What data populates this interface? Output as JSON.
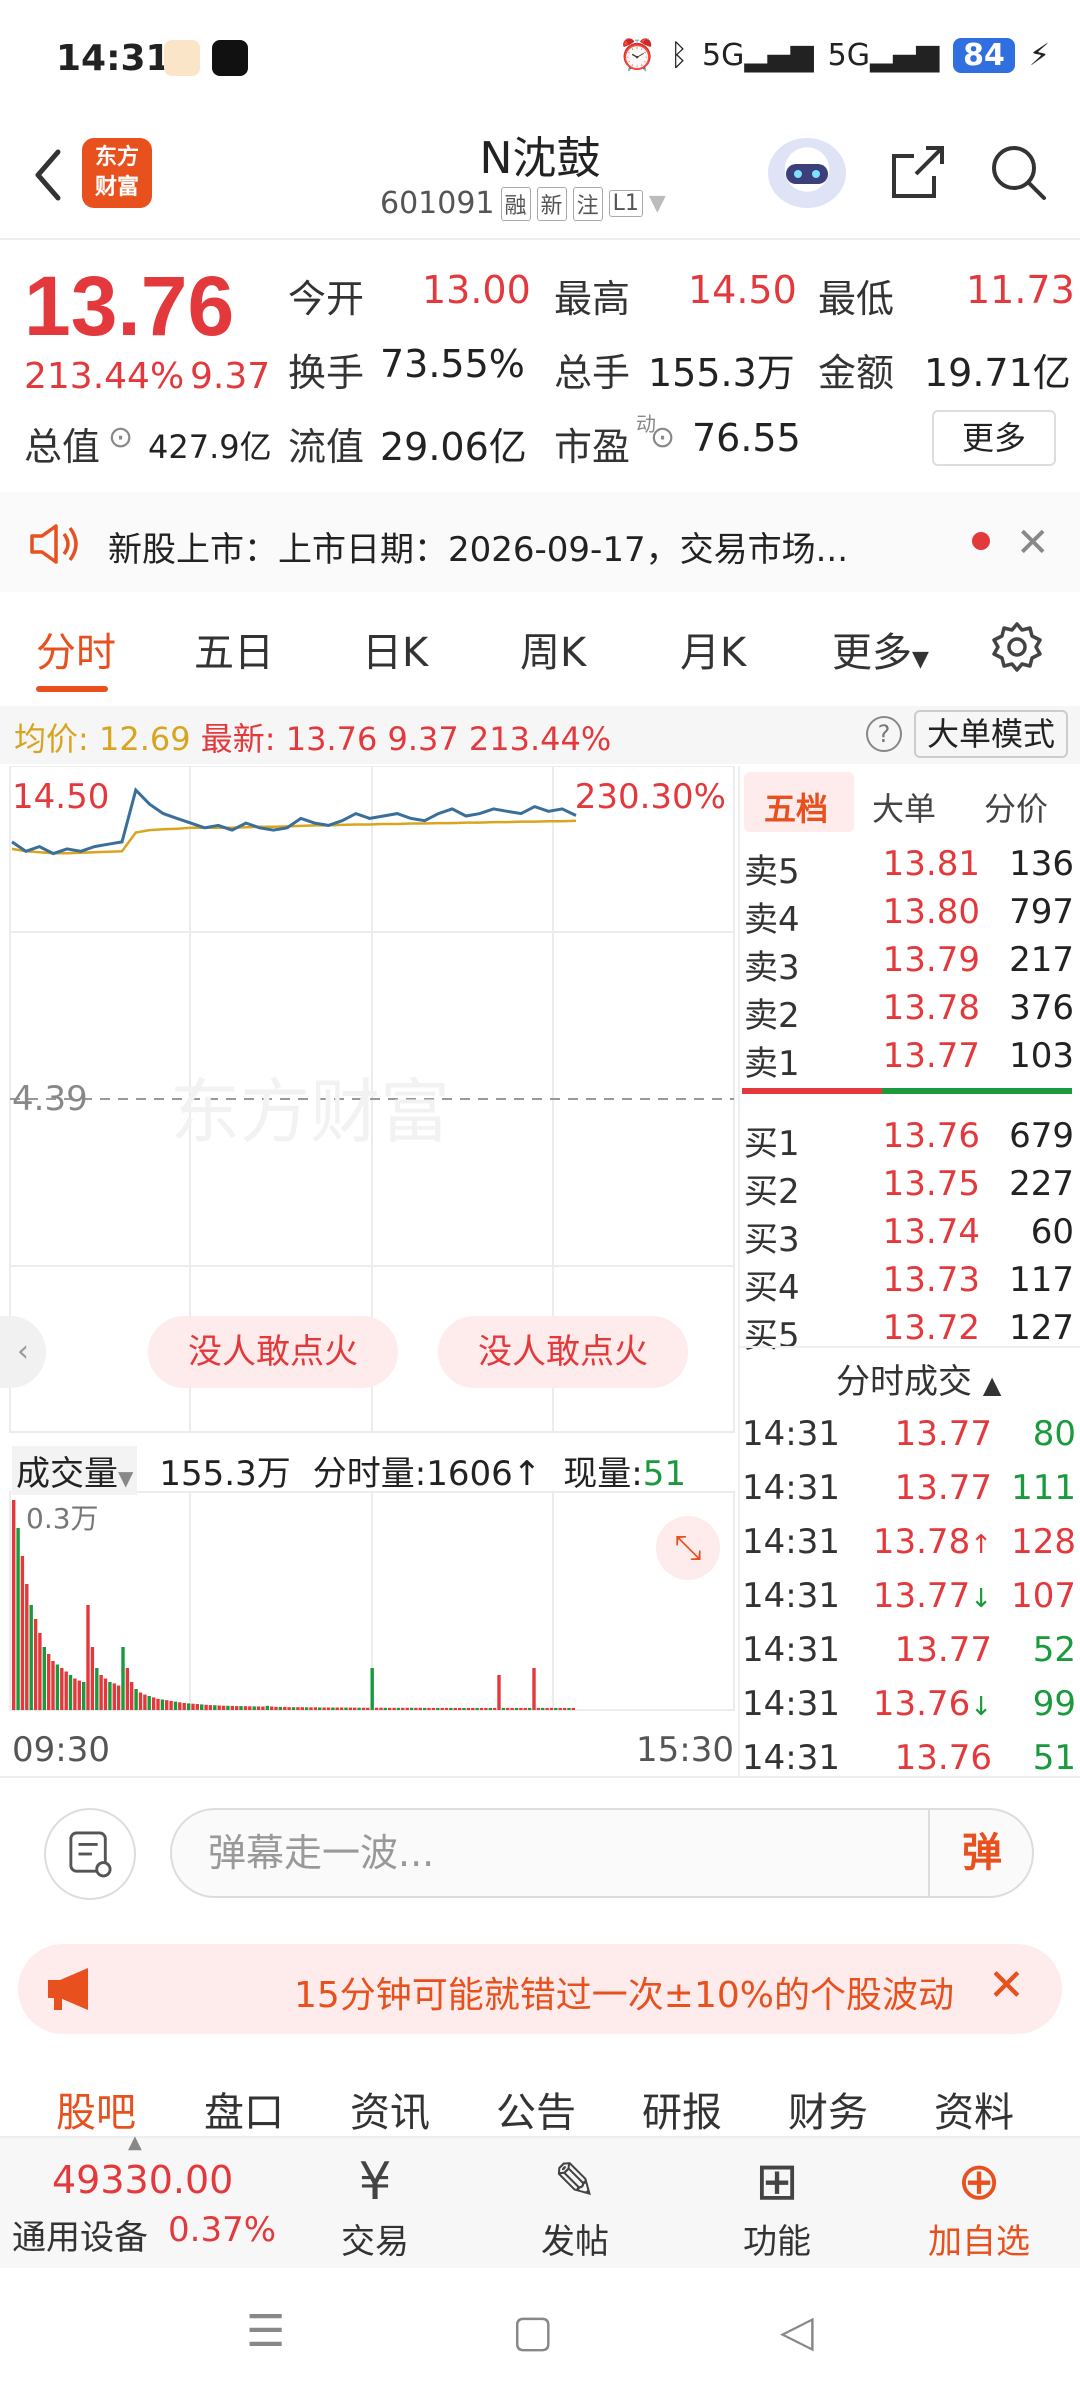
{
  "status_bar": {
    "time": "14:31",
    "signal1": "5G",
    "signal2": "5G",
    "battery": "84"
  },
  "header": {
    "logo_text_line1": "东方",
    "logo_text_line2": "财富",
    "stock_name": "N沈鼓",
    "stock_code": "601091",
    "tags": [
      "融",
      "新",
      "注",
      "L1"
    ]
  },
  "quote": {
    "price": "13.76",
    "change_pct": "213.44%",
    "change_val": "9.37",
    "open_label": "今开",
    "open": "13.00",
    "high_label": "最高",
    "high": "14.50",
    "low_label": "最低",
    "low": "11.73",
    "turnover_label": "换手",
    "turnover": "73.55%",
    "volume_label": "总手",
    "volume": "155.3万",
    "amount_label": "金额",
    "amount": "19.71亿",
    "mktcap_label": "总值",
    "mktcap": "427.9亿",
    "float_label": "流值",
    "float_cap": "29.06亿",
    "pe_label": "市盈",
    "pe_sup": "动",
    "pe": "76.55",
    "more_label": "更多"
  },
  "notice": {
    "text": "新股上市：上市日期：2026-09-17，交易市场..."
  },
  "chart_tabs": [
    "分时",
    "五日",
    "日K",
    "周K",
    "月K",
    "更多"
  ],
  "avg_bar": {
    "avg_label": "均价:",
    "avg": "12.69",
    "latest_label": "最新:",
    "latest": "13.76",
    "chg": "9.37",
    "pct": "213.44%",
    "help": "?",
    "big_order_mode": "大单模式"
  },
  "chart": {
    "y_top_label": "14.50",
    "y_top_pct": "230.30%",
    "y_mid_label": "4.39",
    "watermark": "东方财富",
    "ghost_btn": "没人敢点火",
    "vol_label": "成交量",
    "vol_total": "155.3万",
    "tick_vol_label": "分时量:",
    "tick_vol": "1606",
    "cur_vol_label": "现量:",
    "cur_vol": "51",
    "vol_scale": "0.3万",
    "time_start": "09:30",
    "time_end": "15:30"
  },
  "chart_data": {
    "type": "line",
    "series": [
      {
        "values": [
          13.2,
          13.0,
          13.1,
          12.95,
          13.05,
          13.0,
          13.1,
          13.15,
          13.2,
          14.3,
          14.0,
          13.8,
          13.7,
          13.6,
          13.5,
          13.55,
          13.45,
          13.6,
          13.5,
          13.45,
          13.5,
          13.7,
          13.6,
          13.55,
          13.65,
          13.8,
          13.7,
          13.75,
          13.8,
          13.7,
          13.65,
          13.8,
          13.9,
          13.75,
          13.8,
          13.9,
          13.85,
          13.8,
          13.95,
          13.85,
          13.9,
          13.76
        ]
      },
      {
        "values": [
          13.05,
          13.0,
          12.98,
          12.96,
          12.96,
          12.97,
          12.98,
          12.99,
          13.0,
          13.4,
          13.45,
          13.47,
          13.48,
          13.5,
          13.5,
          13.5,
          13.5,
          13.51,
          13.52,
          13.52,
          13.53,
          13.54,
          13.55,
          13.55,
          13.56,
          13.57,
          13.57,
          13.58,
          13.58,
          13.59,
          13.59,
          13.6,
          13.6,
          13.61,
          13.61,
          13.62,
          13.62,
          13.63,
          13.63,
          13.64,
          13.64,
          13.65
        ]
      }
    ],
    "volume": [
      3000,
      2600,
      2200,
      1800,
      1500,
      1300,
      1100,
      900,
      800,
      700,
      650,
      600,
      550,
      500,
      450,
      420,
      400,
      1500,
      900,
      600,
      500,
      450,
      400,
      380,
      350,
      900,
      600,
      400,
      300,
      250,
      220,
      200,
      180,
      160,
      150,
      140,
      130,
      120,
      110,
      100,
      95,
      90,
      85,
      80,
      75,
      70,
      68,
      65,
      62,
      60,
      58,
      56,
      55,
      54,
      53,
      52,
      51,
      50,
      60,
      50,
      45,
      45,
      45,
      40,
      40,
      40,
      40,
      38,
      38,
      38,
      36,
      36,
      36,
      35,
      35,
      35,
      34,
      34,
      34,
      33,
      33,
      33,
      600,
      33,
      33,
      32,
      32,
      32,
      32,
      31,
      31,
      31,
      31,
      31,
      30,
      30,
      30,
      30,
      30,
      30,
      30,
      30,
      30,
      30,
      30,
      30,
      30,
      30,
      30,
      30,
      30,
      500,
      30,
      30,
      30,
      30,
      30,
      30,
      30,
      600,
      30,
      30,
      30,
      30,
      30,
      30,
      30,
      30,
      30
    ],
    "ylim": [
      4.39,
      14.5
    ]
  },
  "order_book": {
    "tabs": [
      "五档",
      "大单",
      "分价"
    ],
    "asks": [
      {
        "label": "卖5",
        "price": "13.81",
        "vol": "136"
      },
      {
        "label": "卖4",
        "price": "13.80",
        "vol": "797"
      },
      {
        "label": "卖3",
        "price": "13.79",
        "vol": "217"
      },
      {
        "label": "卖2",
        "price": "13.78",
        "vol": "376"
      },
      {
        "label": "卖1",
        "price": "13.77",
        "vol": "103"
      }
    ],
    "bids": [
      {
        "label": "买1",
        "price": "13.76",
        "vol": "679"
      },
      {
        "label": "买2",
        "price": "13.75",
        "vol": "227"
      },
      {
        "label": "买3",
        "price": "13.74",
        "vol": "60"
      },
      {
        "label": "买4",
        "price": "13.73",
        "vol": "117"
      },
      {
        "label": "买5",
        "price": "13.72",
        "vol": "127"
      }
    ],
    "trades_title": "分时成交",
    "trades": [
      {
        "time": "14:31",
        "price": "13.77",
        "arrow": "",
        "vol": "80",
        "side": "buy"
      },
      {
        "time": "14:31",
        "price": "13.77",
        "arrow": "",
        "vol": "111",
        "side": "buy"
      },
      {
        "time": "14:31",
        "price": "13.78",
        "arrow": "↑",
        "vol": "128",
        "side": "sell"
      },
      {
        "time": "14:31",
        "price": "13.77",
        "arrow": "↓",
        "vol": "107",
        "side": "sell"
      },
      {
        "time": "14:31",
        "price": "13.77",
        "arrow": "",
        "vol": "52",
        "side": "buy"
      },
      {
        "time": "14:31",
        "price": "13.76",
        "arrow": "↓",
        "vol": "99",
        "side": "buy"
      },
      {
        "time": "14:31",
        "price": "13.76",
        "arrow": "",
        "vol": "51",
        "side": "buy"
      }
    ]
  },
  "bullet": {
    "placeholder": "弹幕走一波...",
    "send": "弹"
  },
  "promo": {
    "text": "15分钟可能就错过一次±10%的个股波动"
  },
  "content_tabs": [
    "股吧",
    "盘口",
    "资讯",
    "公告",
    "研报",
    "财务",
    "资料"
  ],
  "bottom_nav": {
    "index_value": "49330.00",
    "index_name": "通用设备",
    "index_pct": "0.37%",
    "items": [
      {
        "icon": "¥",
        "label": "交易"
      },
      {
        "icon": "✎",
        "label": "发帖"
      },
      {
        "icon": "⊞",
        "label": "功能"
      },
      {
        "icon": "⊕",
        "label": "加自选"
      }
    ]
  },
  "colors": {
    "up_red": "#e4393c",
    "down_green": "#1a9a3c",
    "brand_orange": "#e8501e",
    "avg_yellow": "#d9a520",
    "price_line_blue": "#3a6f99"
  }
}
